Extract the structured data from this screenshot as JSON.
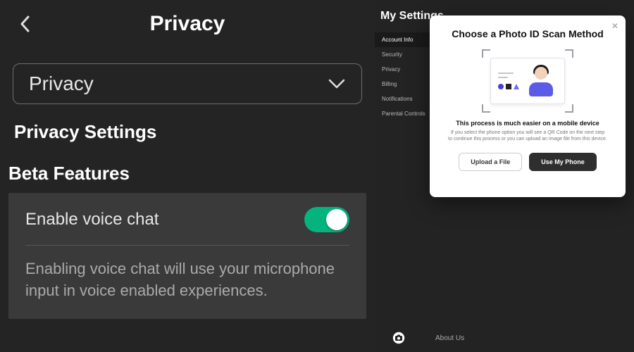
{
  "left": {
    "page_title": "Privacy",
    "dropdown": {
      "selected": "Privacy"
    },
    "section_title": "Privacy Settings",
    "beta_title": "Beta Features",
    "voice_chat": {
      "label": "Enable voice chat",
      "enabled": true,
      "description": "Enabling voice chat will use your microphone input in voice enabled experiences."
    }
  },
  "right": {
    "title": "My Settings",
    "nav": {
      "items": [
        {
          "label": "Account Info",
          "active": true
        },
        {
          "label": "Security",
          "active": false
        },
        {
          "label": "Privacy",
          "active": false
        },
        {
          "label": "Billing",
          "active": false
        },
        {
          "label": "Notifications",
          "active": false
        },
        {
          "label": "Parental Controls",
          "active": false
        }
      ]
    },
    "footer": {
      "about": "About Us"
    }
  },
  "modal": {
    "title": "Choose a Photo ID Scan Method",
    "subtitle": "This process is much easier on a mobile device",
    "description": "If you select the phone option you will see a QR Code on the next step to continue this process or you can upload an image file from this device.",
    "upload_label": "Upload a File",
    "phone_label": "Use My Phone"
  }
}
